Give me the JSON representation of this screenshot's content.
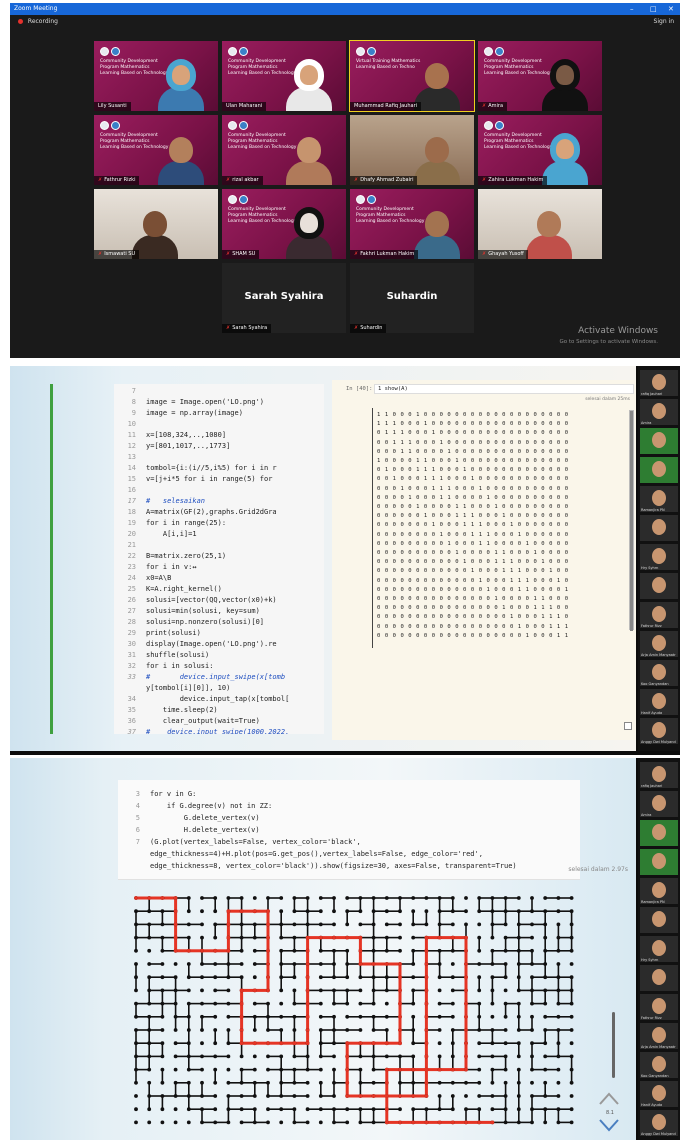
{
  "zoom": {
    "window_title": "Zoom Meeting",
    "recording_label": "Recording",
    "sign_in": "Sign in",
    "slide_text": "Community Development Program Mathematics Learning Based on Technology",
    "speaker_slide_text": "Virtual Training Mathematics Learning Based on Techno",
    "participants": [
      {
        "name": "Lily Susanti"
      },
      {
        "name": "Ulan Maharani"
      },
      {
        "name": "Muhammad Rafiq Jauhari"
      },
      {
        "name": "Amira"
      },
      {
        "name": "Fathrur Rizki"
      },
      {
        "name": "rizal akbar"
      },
      {
        "name": "Dhafy Ahmad Zubairi"
      },
      {
        "name": "Zahira Lukman Hakim"
      },
      {
        "name": "Ismawati SU"
      },
      {
        "name": "SHAM SU"
      },
      {
        "name": "Fakhri Lukman Hakim"
      },
      {
        "name": "Ghayah Yusoff"
      },
      {
        "name": "Sarah Syahira"
      },
      {
        "name": "Suhardin"
      }
    ],
    "watermark_title": "Activate Windows",
    "watermark_sub": "Go to Settings to activate Windows."
  },
  "notebook1": {
    "code_lines": [
      {
        "n": "7",
        "t": ""
      },
      {
        "n": "8",
        "t": "image = Image.open('LO.png')"
      },
      {
        "n": "9",
        "t": "image = np.array(image)"
      },
      {
        "n": "10",
        "t": ""
      },
      {
        "n": "11",
        "t": "x=[108,324,..,1080]"
      },
      {
        "n": "12",
        "t": "y=[801,1017,..,1773]"
      },
      {
        "n": "13",
        "t": ""
      },
      {
        "n": "14",
        "t": "tombol={i:(i//5,i%5) for i in r"
      },
      {
        "n": "15",
        "t": "v=[j+i*5 for i in range(5) for"
      },
      {
        "n": "16",
        "t": ""
      },
      {
        "n": "17",
        "t": "#   selesaikan"
      },
      {
        "n": "18",
        "t": "A=matrix(GF(2),graphs.Grid2dGra"
      },
      {
        "n": "19",
        "t": "for i in range(25):"
      },
      {
        "n": "20",
        "t": "    A[i,i]=1"
      },
      {
        "n": "21",
        "t": ""
      },
      {
        "n": "22",
        "t": "B=matrix.zero(25,1)"
      },
      {
        "n": "23",
        "t": "for i in v:↔"
      },
      {
        "n": "24",
        "t": "x0=A\\B"
      },
      {
        "n": "25",
        "t": "K=A.right_kernel()"
      },
      {
        "n": "26",
        "t": "solusi=[vector(QQ,vector(x0)+k)"
      },
      {
        "n": "27",
        "t": "solusi=min(solusi, key=sum)"
      },
      {
        "n": "28",
        "t": "solusi=np.nonzero(solusi)[0]"
      },
      {
        "n": "29",
        "t": "print(solusi)"
      },
      {
        "n": "30",
        "t": "display(Image.open('LO.png').re"
      },
      {
        "n": "31",
        "t": "shuffle(solusi)"
      },
      {
        "n": "32",
        "t": "for i in solusi:"
      },
      {
        "n": "33",
        "t": "#       device.input_swipe(x[tomb"
      },
      {
        "n": "",
        "t": "y[tombol[i][0]], 10)"
      },
      {
        "n": "34",
        "t": "        device.input_tap(x[tombol["
      },
      {
        "n": "35",
        "t": "    time.sleep(2)"
      },
      {
        "n": "36",
        "t": "    clear_output(wait=True)"
      },
      {
        "n": "37",
        "t": "#    device.input_swipe(1000,2022,"
      }
    ],
    "in_prompt": "In [40]:",
    "in_code": "1   show(A)",
    "done_text": "selesai dalam 25ms",
    "matrix_rows": [
      "1 1 0 0 0 1 0 0 0 0 0 0 0 0 0 0 0 0 0 0 0 0 0 0 0",
      "1 1 1 0 0 0 1 0 0 0 0 0 0 0 0 0 0 0 0 0 0 0 0 0 0",
      "0 1 1 1 0 0 0 1 0 0 0 0 0 0 0 0 0 0 0 0 0 0 0 0 0",
      "0 0 1 1 1 0 0 0 1 0 0 0 0 0 0 0 0 0 0 0 0 0 0 0 0",
      "0 0 0 1 1 0 0 0 0 1 0 0 0 0 0 0 0 0 0 0 0 0 0 0 0",
      "1 0 0 0 0 1 1 0 0 0 1 0 0 0 0 0 0 0 0 0 0 0 0 0 0",
      "0 1 0 0 0 1 1 1 0 0 0 1 0 0 0 0 0 0 0 0 0 0 0 0 0",
      "0 0 1 0 0 0 1 1 1 0 0 0 1 0 0 0 0 0 0 0 0 0 0 0 0",
      "0 0 0 1 0 0 0 1 1 1 0 0 0 1 0 0 0 0 0 0 0 0 0 0 0",
      "0 0 0 0 1 0 0 0 1 1 0 0 0 0 1 0 0 0 0 0 0 0 0 0 0",
      "0 0 0 0 0 1 0 0 0 0 1 1 0 0 0 1 0 0 0 0 0 0 0 0 0",
      "0 0 0 0 0 0 1 0 0 0 1 1 1 0 0 0 1 0 0 0 0 0 0 0 0",
      "0 0 0 0 0 0 0 1 0 0 0 1 1 1 0 0 0 1 0 0 0 0 0 0 0",
      "0 0 0 0 0 0 0 0 1 0 0 0 1 1 1 0 0 0 1 0 0 0 0 0 0",
      "0 0 0 0 0 0 0 0 0 1 0 0 0 1 1 0 0 0 0 1 0 0 0 0 0",
      "0 0 0 0 0 0 0 0 0 0 1 0 0 0 0 1 1 0 0 0 1 0 0 0 0",
      "0 0 0 0 0 0 0 0 0 0 0 1 0 0 0 1 1 1 0 0 0 1 0 0 0",
      "0 0 0 0 0 0 0 0 0 0 0 0 1 0 0 0 1 1 1 0 0 0 1 0 0",
      "0 0 0 0 0 0 0 0 0 0 0 0 0 1 0 0 0 1 1 1 0 0 0 1 0",
      "0 0 0 0 0 0 0 0 0 0 0 0 0 0 1 0 0 0 1 1 0 0 0 0 1",
      "0 0 0 0 0 0 0 0 0 0 0 0 0 0 0 1 0 0 0 0 1 1 0 0 0",
      "0 0 0 0 0 0 0 0 0 0 0 0 0 0 0 0 1 0 0 0 1 1 1 0 0",
      "0 0 0 0 0 0 0 0 0 0 0 0 0 0 0 0 0 1 0 0 0 1 1 1 0",
      "0 0 0 0 0 0 0 0 0 0 0 0 0 0 0 0 0 0 1 0 0 0 1 1 1",
      "0 0 0 0 0 0 0 0 0 0 0 0 0 0 0 0 0 0 0 1 0 0 0 1 1"
    ]
  },
  "sidebar_thumbs": [
    {
      "label": "rafiq Jauhari",
      "green": false
    },
    {
      "label": "Amira",
      "green": false
    },
    {
      "label": "",
      "green": true
    },
    {
      "label": "",
      "green": true
    },
    {
      "label": "Ramanjira PN",
      "green": false
    },
    {
      "label": "",
      "green": false
    },
    {
      "label": "Hry Syhrn",
      "green": false
    },
    {
      "label": "",
      "green": false
    },
    {
      "label": "Fathrur Rizz",
      "green": false
    },
    {
      "label": "Arja Amin Manyaatr",
      "green": false
    },
    {
      "label": "Koo Ganyandan",
      "green": false
    },
    {
      "label": "Hanif Ayuda",
      "green": false
    },
    {
      "label": "Anggy Dwi Mulyand",
      "green": false
    }
  ],
  "notebook2": {
    "code_lines": [
      {
        "n": "3",
        "t": "for v in G:"
      },
      {
        "n": "4",
        "t": "    if G.degree(v) not in ZZ:"
      },
      {
        "n": "5",
        "t": "        G.delete_vertex(v)"
      },
      {
        "n": "6",
        "t": "        H.delete_vertex(v)"
      },
      {
        "n": "7",
        "t": "(G.plot(vertex_labels=False, vertex_color='black',"
      },
      {
        "n": "",
        "t": "edge_thickness=4)+H.plot(pos=G.get_pos(),vertex_labels=False, edge_color='red',"
      },
      {
        "n": "",
        "t": "edge_thickness=8, vertex_color='black')).show(figsize=30, axes=False, transparent=True)"
      }
    ],
    "done_text": "selesai dalam 2.97s",
    "nav_text": "8.1"
  },
  "colors": {
    "zoom_blue": "#1767d8",
    "slide_magenta": "#8a1950",
    "maze_red": "#e53424",
    "maze_black": "#111111"
  }
}
